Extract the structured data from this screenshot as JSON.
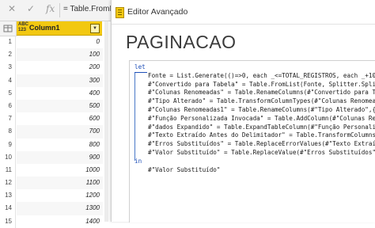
{
  "formula_bar": {
    "close_icon": "close-x-icon",
    "confirm_icon": "check-icon",
    "fx_label": "fx",
    "formula": "= Table.FromL"
  },
  "grid": {
    "corner_icon": "table-icon",
    "column": {
      "type_label": "ABC 123",
      "name": "Column1",
      "filter_icon": "dropdown-filter-icon"
    },
    "rows": [
      {
        "n": "1",
        "v": "0"
      },
      {
        "n": "2",
        "v": "100"
      },
      {
        "n": "3",
        "v": "200"
      },
      {
        "n": "4",
        "v": "300"
      },
      {
        "n": "5",
        "v": "400"
      },
      {
        "n": "6",
        "v": "500"
      },
      {
        "n": "7",
        "v": "600"
      },
      {
        "n": "8",
        "v": "700"
      },
      {
        "n": "9",
        "v": "800"
      },
      {
        "n": "10",
        "v": "900"
      },
      {
        "n": "11",
        "v": "1000"
      },
      {
        "n": "12",
        "v": "1100"
      },
      {
        "n": "13",
        "v": "1200"
      },
      {
        "n": "14",
        "v": "1300"
      },
      {
        "n": "15",
        "v": "1400"
      }
    ]
  },
  "editor": {
    "window_title": "Editor Avançado",
    "query_name": "PAGINACAO",
    "code": [
      "let",
      "Fonte = List.Generate(()=>0, each _<=TOTAL_REGISTROS, each _+100),",
      "#\"Convertido para Tabela\" = Table.FromList(Fonte, Splitter.SplitByNo",
      "#\"Colunas Renomeadas\" = Table.RenameColumns(#\"Convertido para Tabela",
      "#\"Tipo Alterado\" = Table.TransformColumnTypes(#\"Colunas Renomeadas\",",
      "#\"Colunas Renomeadas1\" = Table.RenameColumns(#\"Tipo Alterado\",{{\"pag",
      "#\"Função Personalizada Invocada\" = Table.AddColumn(#\"Colunas Renomea",
      "#\"dados Expandido\" = Table.ExpandTableColumn(#\"Função Personalizada",
      "#\"Texto Extraído Antes do Delimitador\" = Table.TransformColumns(#\"da",
      "#\"Erros Substituídos\" = Table.ReplaceErrorValues(#\"Texto Extraído An",
      "#\"Valor Substituído\" = Table.ReplaceValue(#\"Erros Substituídos\",\"\",\"",
      "in",
      "#\"Valor Substituído\""
    ]
  },
  "colors": {
    "column_header": "#f2c811",
    "keyword": "#1e4fb8"
  }
}
